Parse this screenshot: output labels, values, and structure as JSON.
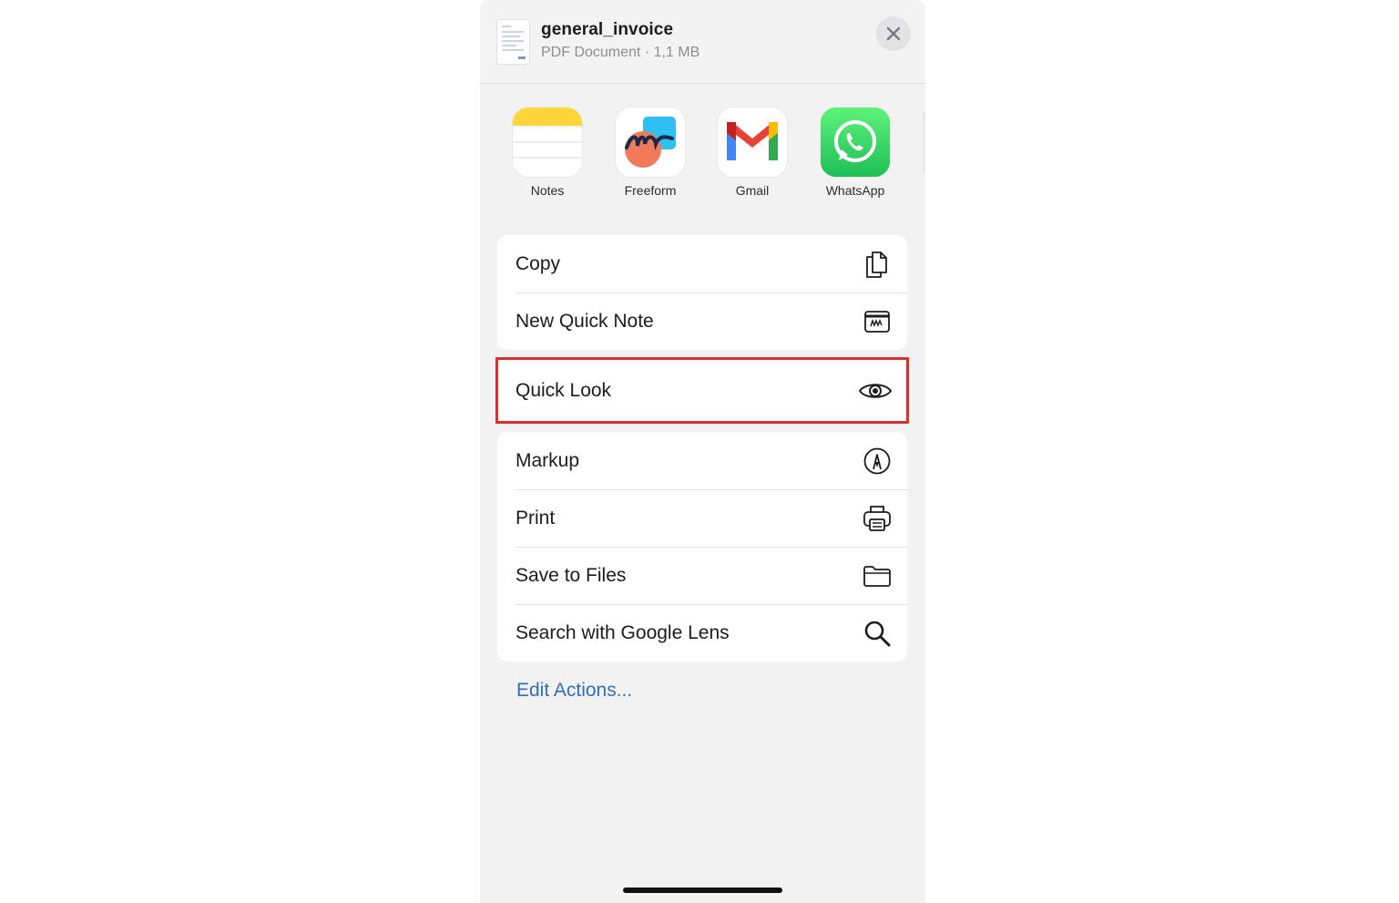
{
  "file": {
    "name": "general_invoice",
    "meta": "PDF Document · 1,1 MB"
  },
  "apps": [
    {
      "label": "Notes",
      "icon": "notes-app-icon"
    },
    {
      "label": "Freeform",
      "icon": "freeform-app-icon"
    },
    {
      "label": "Gmail",
      "icon": "gmail-app-icon"
    },
    {
      "label": "WhatsApp",
      "icon": "whatsapp-app-icon"
    }
  ],
  "actions": {
    "group1": [
      {
        "label": "Copy",
        "icon": "copy-icon"
      },
      {
        "label": "New Quick Note",
        "icon": "quick-note-icon"
      }
    ],
    "highlighted": {
      "label": "Quick Look",
      "icon": "eye-icon"
    },
    "group2": [
      {
        "label": "Markup",
        "icon": "markup-pen-icon"
      },
      {
        "label": "Print",
        "icon": "printer-icon"
      },
      {
        "label": "Save to Files",
        "icon": "folder-icon"
      },
      {
        "label": "Search with Google Lens",
        "icon": "search-icon"
      }
    ]
  },
  "edit_actions_label": "Edit Actions...",
  "colors": {
    "highlight_border": "#e02d2d",
    "link": "#2f6fbe",
    "sheet_background": "#f2f2f2",
    "whatsapp_green": "#25d366"
  }
}
